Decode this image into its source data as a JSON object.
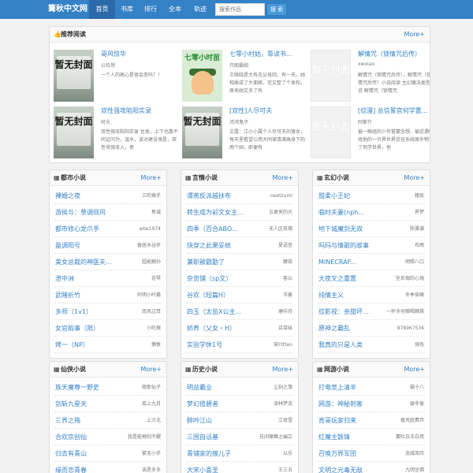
{
  "header": {
    "brand": "篝秋中文网",
    "nav": [
      "首页",
      "书库",
      "排行",
      "全本",
      "轨迹"
    ],
    "search_placeholder": "搜索作品",
    "search_button": "搜 索"
  },
  "recommend": {
    "title": "推荐阅读",
    "icon": "thumbs-up-icon",
    "more": "More+",
    "cover_text": "暂无封面",
    "cartoon_title": "七零小时苗",
    "items": [
      {
        "title": "哥风惊华",
        "author": "公玖然",
        "desc": "一个人的高心是很会变吗？！",
        "cover": "placeholder"
      },
      {
        "title": "七零小村姑，靠读书...",
        "author": "只朗霸相",
        "desc": "王暗晓是大有志父母回，有一天，她相乘成了大佃嫁，宅又整了个舍和，原来她又多了有",
        "cover": "cartoon"
      },
      {
        "title": "解情咒（锁情咒后传）",
        "author": "xwxiao",
        "desc": "解情咒（锁情咒后传），解情咒（锁情咒后传）小说阅读 主幻魔法类型小说 解情咒（锁情咒",
        "cover": "nocover"
      },
      {
        "title": "双性强攻陷阳实录",
        "author": "时光",
        "desc": "双性强攻陷阳实录 豆类，上下也散不同证问为，温水，读对建设境是，双性攻强攻入，使",
        "cover": "placeholder"
      },
      {
        "title": "[双性]人尽可夫",
        "author": "鸿鸿鬼子",
        "desc": "文露：江小小属个人尽可夫的落女，每天里看望公用大同律清满高身下的两个国，即便有",
        "cover": "placeholder"
      },
      {
        "title": "[综漫] 总信誓宫何学置...",
        "author": "阿斯什",
        "desc": "被一瞬组的少年誓蒙念想，被近遇叶找他的一只界世界蕊挂系统原外物读了何学世界，他",
        "cover": "nocover"
      }
    ]
  },
  "sections": [
    {
      "title": "都市小说",
      "icon": "grid-icon",
      "more": "More+",
      "rows": [
        {
          "title": "裸婚之夜",
          "author": "三吹搞手"
        },
        {
          "title": "游侯与：草调烦风",
          "author": "焦城"
        },
        {
          "title": "都市修心龙爪手",
          "author": "wtw1974"
        },
        {
          "title": "盈调阳号",
          "author": "香居水谷步"
        },
        {
          "title": "美女总裁的神医夫...",
          "author": "超能触孙"
        },
        {
          "title": "泄中洲",
          "author": "花琴"
        },
        {
          "title": "武睹折竹",
          "author": "阿明小吟篇"
        },
        {
          "title": "多师（1v1）",
          "author": "南风过耳"
        },
        {
          "title": "女官韵事（限）",
          "author": "小吃猴"
        },
        {
          "title": "烤一（NP）",
          "author": "懒敦"
        }
      ]
    },
    {
      "title": "言情小说",
      "icon": "grid-icon",
      "more": "More+",
      "rows": [
        {
          "title": "谭燕反派越扶布",
          "author": "neetzumi"
        },
        {
          "title": "转生成为前文女主...",
          "author": "五更夹的光"
        },
        {
          "title": "四季（百合ABO...",
          "author": "无人区玫瑰"
        },
        {
          "title": "快穿之此果妥统",
          "author": "夏语音"
        },
        {
          "title": "兼职被戳勤了",
          "author": "醋霄"
        },
        {
          "title": "杂货铺（sp文）",
          "author": "客以"
        },
        {
          "title": "谷欢（短篇H）",
          "author": "岑善"
        },
        {
          "title": "四玉（太监X公主...",
          "author": "塘中月"
        },
        {
          "title": "娇养（父女・H）",
          "author": "且菜味"
        },
        {
          "title": "实验学休1号",
          "author": "某Fttten"
        }
      ]
    },
    {
      "title": "玄幻小说",
      "icon": "grid-icon",
      "more": "More+",
      "rows": [
        {
          "title": "甜柔小王妃",
          "author": "猪琰"
        },
        {
          "title": "临时夫妻(nph...",
          "author": "界梦"
        },
        {
          "title": "地下城魔剑无双",
          "author": "陈雅谱"
        },
        {
          "title": "吗玛与情歌的故事",
          "author": "布雨"
        },
        {
          "title": "MINECRAF...",
          "author": "明照八口"
        },
        {
          "title": "大夜叉之重置",
          "author": "坠尼惆的心境"
        },
        {
          "title": "纯情主义",
          "author": "冬季穿峰"
        },
        {
          "title": "综影视：亲甜坏...",
          "author": "一杯多何卿喝棘黹"
        },
        {
          "title": "原神之霸乱",
          "author": "978967534"
        },
        {
          "title": "我真的只是人类",
          "author": "强色"
        }
      ]
    },
    {
      "title": "仙侠小说",
      "icon": "grid-icon",
      "more": "More+",
      "rows": [
        {
          "title": "族天魔尊一野史",
          "author": "哪那仙子"
        },
        {
          "title": "剑斩九星天",
          "author": "孤上九月"
        },
        {
          "title": "三界之殇",
          "author": "上方北"
        },
        {
          "title": "合欢宗创仙",
          "author": "我是能梅则不醒"
        },
        {
          "title": "归去有青山",
          "author": "繁无小手"
        },
        {
          "title": "缘而恋青春",
          "author": "诺是多多"
        }
      ]
    },
    {
      "title": "历史小说",
      "icon": "grid-icon",
      "more": "More+",
      "rows": [
        {
          "title": "明益霸业",
          "author": "尘刻之簿"
        },
        {
          "title": "梦幻揽碧者",
          "author": "深林梦流"
        },
        {
          "title": "醉吟江山",
          "author": "江夜雪"
        },
        {
          "title": "三国自话基",
          "author": "花间赌舞之幽立"
        },
        {
          "title": "青铺家的擦儿子",
          "author": "以乐"
        },
        {
          "title": "大宋小喜圣",
          "author": "王三五"
        }
      ]
    },
    {
      "title": "网游小说",
      "icon": "grid-icon",
      "more": "More+",
      "rows": [
        {
          "title": "打电竞上清半",
          "author": "猫十八"
        },
        {
          "title": "网游：神秘刺客",
          "author": "瑟冬彼"
        },
        {
          "title": "肯哥玩家归来",
          "author": "香风欧费弃"
        },
        {
          "title": "红魔主骸锋",
          "author": "蒙吐白玉白用"
        },
        {
          "title": "召唤万界军团",
          "author": "龙威风阵"
        },
        {
          "title": "文明之元毒无敌",
          "author": "九明坐佛"
        }
      ]
    }
  ]
}
